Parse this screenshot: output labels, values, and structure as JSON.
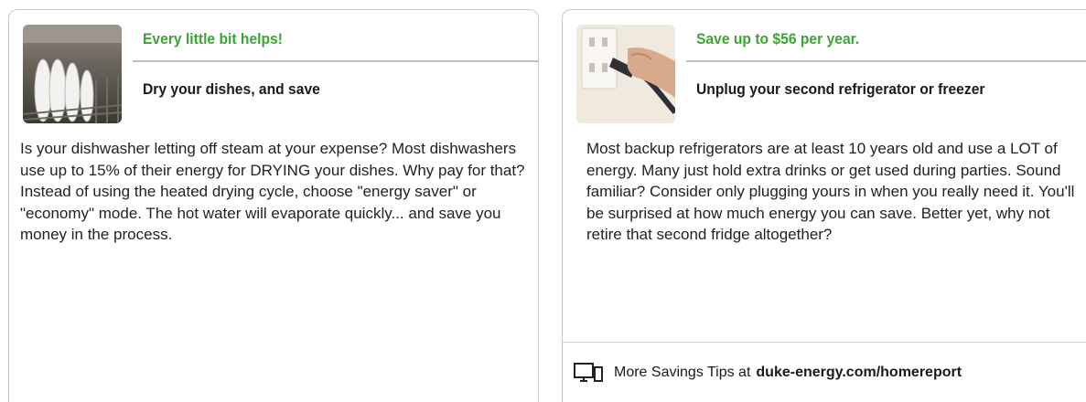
{
  "cards": [
    {
      "headline": "Every little bit helps!",
      "subhead": "Dry your dishes, and save",
      "body": "Is your dishwasher letting off steam at your expense? Most dishwashers use up to 15% of their energy for DRYING your dishes. Why pay for that? Instead of using the heated drying cycle, choose \"energy saver\" or \"economy\" mode. The hot water will evaporate quickly... and save you money in the process.",
      "image_icon": "dishwasher-rack-photo"
    },
    {
      "headline": "Save up to $56 per year.",
      "subhead": "Unplug your second refrigerator or freezer",
      "body": "Most backup refrigerators are at least 10 years old and use a LOT of energy. Many just hold extra drinks or get used during parties. Sound familiar? Consider only plugging yours in when you really need it. You'll be surprised at how much energy you can save. Better yet, why not retire that second fridge altogether?",
      "image_icon": "unplugging-cord-photo",
      "footer": {
        "icon": "computer-monitor-icon",
        "label": "More Savings Tips at",
        "url": "duke-energy.com/homereport"
      }
    }
  ],
  "colors": {
    "headline_green": "#3aa530",
    "border": "#c9c9c9"
  }
}
